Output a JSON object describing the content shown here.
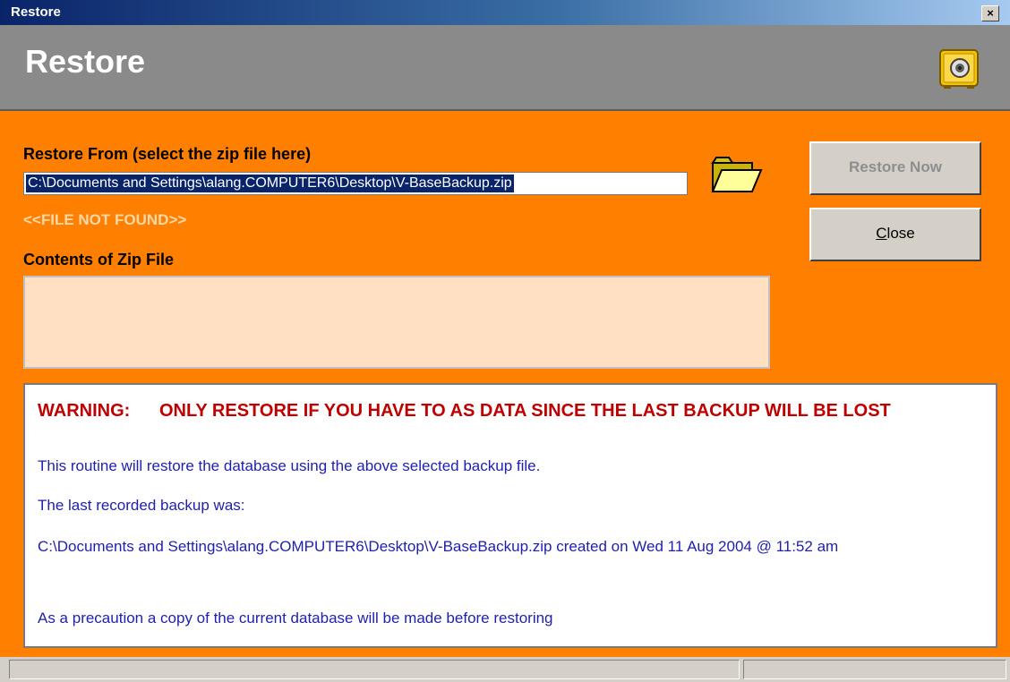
{
  "window": {
    "title": "Restore",
    "close_glyph": "×",
    "accent_color": "#ff8000",
    "header_color": "#8a8a8a"
  },
  "header": {
    "title": "Restore",
    "icon": "safe-icon"
  },
  "restore_from": {
    "label": "Restore From (select the zip file here)",
    "path_value": "C:\\Documents and Settings\\alang.COMPUTER6\\Desktop\\V-BaseBackup.zip",
    "browse_icon": "folder-icon",
    "status": "<<FILE NOT FOUND>>"
  },
  "zip_contents": {
    "label": "Contents of Zip File",
    "items": []
  },
  "buttons": {
    "restore_now": "Restore Now",
    "close_mnemonic": "C",
    "close_rest": "lose"
  },
  "message": {
    "warning_label": "WARNING:",
    "warning_text": "ONLY RESTORE IF YOU HAVE TO AS DATA SINCE THE LAST BACKUP WILL BE LOST",
    "line1": "This routine will restore the database using the above selected backup file.",
    "line2": "The last recorded backup was:",
    "line3": "C:\\Documents and Settings\\alang.COMPUTER6\\Desktop\\V-BaseBackup.zip created on Wed 11 Aug 2004 @ 11:52 am",
    "line4": "As a precaution a copy of the current database will be made before restoring"
  }
}
